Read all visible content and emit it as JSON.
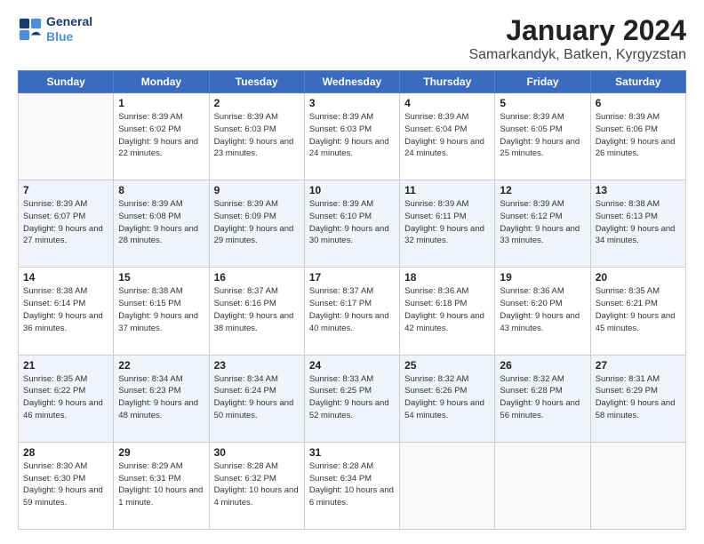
{
  "logo": {
    "line1": "General",
    "line2": "Blue"
  },
  "title": "January 2024",
  "subtitle": "Samarkandyk, Batken, Kyrgyzstan",
  "days_header": [
    "Sunday",
    "Monday",
    "Tuesday",
    "Wednesday",
    "Thursday",
    "Friday",
    "Saturday"
  ],
  "weeks": [
    [
      {
        "day": "",
        "sunrise": "",
        "sunset": "",
        "daylight": ""
      },
      {
        "day": "1",
        "sunrise": "Sunrise: 8:39 AM",
        "sunset": "Sunset: 6:02 PM",
        "daylight": "Daylight: 9 hours and 22 minutes."
      },
      {
        "day": "2",
        "sunrise": "Sunrise: 8:39 AM",
        "sunset": "Sunset: 6:03 PM",
        "daylight": "Daylight: 9 hours and 23 minutes."
      },
      {
        "day": "3",
        "sunrise": "Sunrise: 8:39 AM",
        "sunset": "Sunset: 6:03 PM",
        "daylight": "Daylight: 9 hours and 24 minutes."
      },
      {
        "day": "4",
        "sunrise": "Sunrise: 8:39 AM",
        "sunset": "Sunset: 6:04 PM",
        "daylight": "Daylight: 9 hours and 24 minutes."
      },
      {
        "day": "5",
        "sunrise": "Sunrise: 8:39 AM",
        "sunset": "Sunset: 6:05 PM",
        "daylight": "Daylight: 9 hours and 25 minutes."
      },
      {
        "day": "6",
        "sunrise": "Sunrise: 8:39 AM",
        "sunset": "Sunset: 6:06 PM",
        "daylight": "Daylight: 9 hours and 26 minutes."
      }
    ],
    [
      {
        "day": "7",
        "sunrise": "Sunrise: 8:39 AM",
        "sunset": "Sunset: 6:07 PM",
        "daylight": "Daylight: 9 hours and 27 minutes."
      },
      {
        "day": "8",
        "sunrise": "Sunrise: 8:39 AM",
        "sunset": "Sunset: 6:08 PM",
        "daylight": "Daylight: 9 hours and 28 minutes."
      },
      {
        "day": "9",
        "sunrise": "Sunrise: 8:39 AM",
        "sunset": "Sunset: 6:09 PM",
        "daylight": "Daylight: 9 hours and 29 minutes."
      },
      {
        "day": "10",
        "sunrise": "Sunrise: 8:39 AM",
        "sunset": "Sunset: 6:10 PM",
        "daylight": "Daylight: 9 hours and 30 minutes."
      },
      {
        "day": "11",
        "sunrise": "Sunrise: 8:39 AM",
        "sunset": "Sunset: 6:11 PM",
        "daylight": "Daylight: 9 hours and 32 minutes."
      },
      {
        "day": "12",
        "sunrise": "Sunrise: 8:39 AM",
        "sunset": "Sunset: 6:12 PM",
        "daylight": "Daylight: 9 hours and 33 minutes."
      },
      {
        "day": "13",
        "sunrise": "Sunrise: 8:38 AM",
        "sunset": "Sunset: 6:13 PM",
        "daylight": "Daylight: 9 hours and 34 minutes."
      }
    ],
    [
      {
        "day": "14",
        "sunrise": "Sunrise: 8:38 AM",
        "sunset": "Sunset: 6:14 PM",
        "daylight": "Daylight: 9 hours and 36 minutes."
      },
      {
        "day": "15",
        "sunrise": "Sunrise: 8:38 AM",
        "sunset": "Sunset: 6:15 PM",
        "daylight": "Daylight: 9 hours and 37 minutes."
      },
      {
        "day": "16",
        "sunrise": "Sunrise: 8:37 AM",
        "sunset": "Sunset: 6:16 PM",
        "daylight": "Daylight: 9 hours and 38 minutes."
      },
      {
        "day": "17",
        "sunrise": "Sunrise: 8:37 AM",
        "sunset": "Sunset: 6:17 PM",
        "daylight": "Daylight: 9 hours and 40 minutes."
      },
      {
        "day": "18",
        "sunrise": "Sunrise: 8:36 AM",
        "sunset": "Sunset: 6:18 PM",
        "daylight": "Daylight: 9 hours and 42 minutes."
      },
      {
        "day": "19",
        "sunrise": "Sunrise: 8:36 AM",
        "sunset": "Sunset: 6:20 PM",
        "daylight": "Daylight: 9 hours and 43 minutes."
      },
      {
        "day": "20",
        "sunrise": "Sunrise: 8:35 AM",
        "sunset": "Sunset: 6:21 PM",
        "daylight": "Daylight: 9 hours and 45 minutes."
      }
    ],
    [
      {
        "day": "21",
        "sunrise": "Sunrise: 8:35 AM",
        "sunset": "Sunset: 6:22 PM",
        "daylight": "Daylight: 9 hours and 46 minutes."
      },
      {
        "day": "22",
        "sunrise": "Sunrise: 8:34 AM",
        "sunset": "Sunset: 6:23 PM",
        "daylight": "Daylight: 9 hours and 48 minutes."
      },
      {
        "day": "23",
        "sunrise": "Sunrise: 8:34 AM",
        "sunset": "Sunset: 6:24 PM",
        "daylight": "Daylight: 9 hours and 50 minutes."
      },
      {
        "day": "24",
        "sunrise": "Sunrise: 8:33 AM",
        "sunset": "Sunset: 6:25 PM",
        "daylight": "Daylight: 9 hours and 52 minutes."
      },
      {
        "day": "25",
        "sunrise": "Sunrise: 8:32 AM",
        "sunset": "Sunset: 6:26 PM",
        "daylight": "Daylight: 9 hours and 54 minutes."
      },
      {
        "day": "26",
        "sunrise": "Sunrise: 8:32 AM",
        "sunset": "Sunset: 6:28 PM",
        "daylight": "Daylight: 9 hours and 56 minutes."
      },
      {
        "day": "27",
        "sunrise": "Sunrise: 8:31 AM",
        "sunset": "Sunset: 6:29 PM",
        "daylight": "Daylight: 9 hours and 58 minutes."
      }
    ],
    [
      {
        "day": "28",
        "sunrise": "Sunrise: 8:30 AM",
        "sunset": "Sunset: 6:30 PM",
        "daylight": "Daylight: 9 hours and 59 minutes."
      },
      {
        "day": "29",
        "sunrise": "Sunrise: 8:29 AM",
        "sunset": "Sunset: 6:31 PM",
        "daylight": "Daylight: 10 hours and 1 minute."
      },
      {
        "day": "30",
        "sunrise": "Sunrise: 8:28 AM",
        "sunset": "Sunset: 6:32 PM",
        "daylight": "Daylight: 10 hours and 4 minutes."
      },
      {
        "day": "31",
        "sunrise": "Sunrise: 8:28 AM",
        "sunset": "Sunset: 6:34 PM",
        "daylight": "Daylight: 10 hours and 6 minutes."
      },
      {
        "day": "",
        "sunrise": "",
        "sunset": "",
        "daylight": ""
      },
      {
        "day": "",
        "sunrise": "",
        "sunset": "",
        "daylight": ""
      },
      {
        "day": "",
        "sunrise": "",
        "sunset": "",
        "daylight": ""
      }
    ]
  ]
}
